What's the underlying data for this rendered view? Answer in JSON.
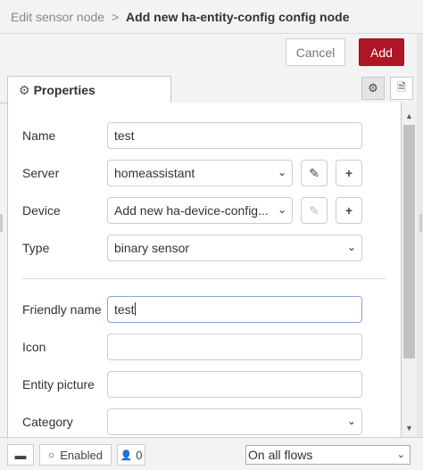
{
  "header": {
    "parent": "Edit sensor node",
    "separator": ">",
    "current": "Add new ha-entity-config config node"
  },
  "toolbar": {
    "cancel_label": "Cancel",
    "add_label": "Add"
  },
  "tabs": [
    {
      "label": "Properties",
      "icon": "gear-icon"
    }
  ],
  "tab_buttons": [
    {
      "icon": "gear-icon",
      "glyph": "⚙"
    },
    {
      "icon": "document-icon",
      "glyph": "🗎"
    }
  ],
  "form": {
    "name": {
      "label": "Name",
      "value": "test"
    },
    "server": {
      "label": "Server",
      "value": "homeassistant"
    },
    "device": {
      "label": "Device",
      "value": "Add new ha-device-config..."
    },
    "type": {
      "label": "Type",
      "value": "binary sensor"
    },
    "friendly_name": {
      "label": "Friendly name",
      "value": "test"
    },
    "icon": {
      "label": "Icon",
      "value": ""
    },
    "entity_picture": {
      "label": "Entity picture",
      "value": ""
    },
    "category": {
      "label": "Category",
      "value": ""
    }
  },
  "footer": {
    "enabled_label": "Enabled",
    "users_count": "0",
    "flows_select": "On all flows"
  },
  "colors": {
    "accent": "#ad1625",
    "focus_border": "#85a4d6"
  }
}
